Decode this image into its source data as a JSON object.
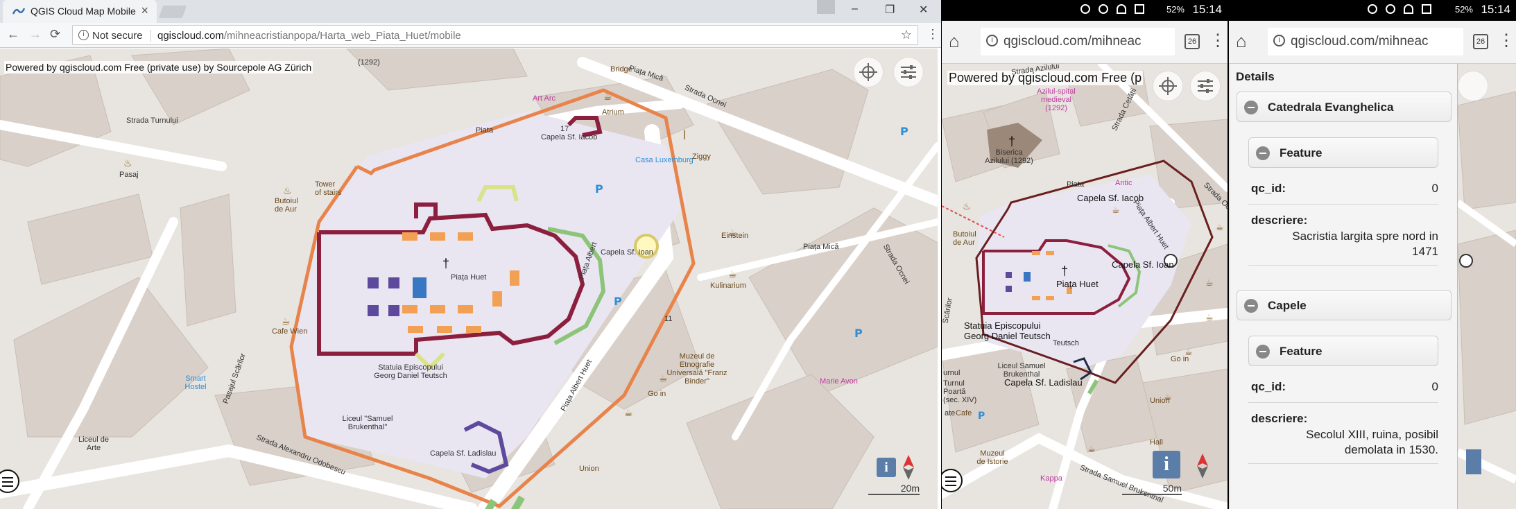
{
  "desktop": {
    "tab_title": "QGIS Cloud Map Mobile",
    "tab_close": "×",
    "window_controls": [
      "–",
      "❐",
      "✕"
    ],
    "nav": {
      "back": "←",
      "forward": "→",
      "reload": "⟳",
      "menu": "⋮"
    },
    "security_label": "Not secure",
    "url_host": "qgiscloud.com",
    "url_path": "/mihneacristianpopa/Harta_web_Piata_Huet/mobile",
    "bookmark_icon": "star-icon",
    "powered_by": "Powered by qgiscloud.com Free (private use) by Sourcepole AG Zürich",
    "info_button": "i",
    "scale": "20m",
    "labels": {
      "strada_turnului": "Strada Turnului",
      "piata_mica": "Piața Mică",
      "strada_ocnei": "Strada Ocnei",
      "piata_mica2": "Piața Mică",
      "strada_ocnei2": "Strada Ocnei",
      "capela_iacob": "Capela Sf. Iacob",
      "capela_ioan": "Capela Sf. Ioan",
      "capela_ladislau": "Capela Sf. Ladislau",
      "piata_huet": "Piața Huet",
      "piata_albert_huet": "Piața Albert Huet",
      "piata_albert": "Piața Albert",
      "statuia": "Statuia Episcopului Georg Daniel Teutsch",
      "pasajul": "Pasajul Scărilor",
      "strada_odobescu": "Strada Alexandru Odobescu",
      "liceul_samuel": "Liceul \"Samuel Brukenthal\"",
      "liceul_arte": "Liceul de Arte",
      "muzeul": "Muzeul de Etnografie Universală \"Franz Binder\"",
      "pasaj": "Pasaj",
      "tower": "Tower of stairs",
      "butoiul": "Butoiul de Aur",
      "cafe_wien": "Cafe Wien",
      "smart_hostel": "Smart Hostel",
      "atrium": "Atrium",
      "art_arc": "Art Arc",
      "casa_lux": "Casa Luxemburg",
      "ziggy": "Ziggy",
      "einstein": "Einstein",
      "kulinarium": "Kulinarium",
      "go_in": "Go in",
      "union": "Union",
      "marie_avon": "Marie Avon",
      "piata": "Piata",
      "bridge": "Bridge",
      "year": "(1292)",
      "num11": "11",
      "num17": "17"
    }
  },
  "phone1": {
    "status": {
      "battery": "52%",
      "time": "15:14"
    },
    "url": "qgiscloud.com/mihneac",
    "tabs_count": "26",
    "powered_by": "Powered by qgiscloud.com Free (p",
    "info_button": "i",
    "scale": "50m",
    "labels": {
      "strada_azilului": "Strada Azilului",
      "azilul_medieval": "Azilul-spital medieval (1292)",
      "biserica": "Biserica Azilului (1292)",
      "piata": "Piata",
      "antic": "Antic",
      "capela_iacob": "Capela Sf. Iacob",
      "piata_albert_huet": "Piața Albert Huet",
      "capela_ioan": "Capela Sf. Ioan",
      "piata_huet": "Piața Huet",
      "statuia": "Statuia Episcopului Georg Daniel Teutsch",
      "capela_ladislau": "Capela Sf. Ladislau",
      "liceul": "Liceul Samuel Brukenthal",
      "turnul_poarta": "Turnul Poartă (sec. XIV)",
      "muzeul_istorie": "Muzeul de Istorie",
      "kappa": "Kappa",
      "strada_samuel": "Strada Samuel Brukenthal",
      "go_in": "Go in",
      "union": "Union",
      "butoiul": "Butoiul de Aur",
      "cafe": "Cafe",
      "strada_ocnei": "Strada Ocnei",
      "strada_cetatii": "Strada Cetății",
      "scarilor": "Scărilor",
      "urnul": "urnul",
      "ate": "ate",
      "hall": "Hall",
      "teutsch": "Teutsch"
    }
  },
  "phone2": {
    "status": {
      "battery": "52%",
      "time": "15:14"
    },
    "url": "qgiscloud.com/mihneac",
    "tabs_count": "26",
    "details": {
      "title": "Details",
      "groups": [
        {
          "name": "Catedrala Evanghelica",
          "feature_label": "Feature",
          "fields": [
            {
              "key": "qc_id:",
              "value": "0"
            },
            {
              "key": "descriere:",
              "value": "Sacristia largita spre nord in 1471"
            }
          ]
        },
        {
          "name": "Capele",
          "feature_label": "Feature",
          "fields": [
            {
              "key": "qc_id:",
              "value": "0"
            },
            {
              "key": "descriere:",
              "value": "Secolul XIII, ruina, posibil demolata in 1530."
            }
          ]
        }
      ]
    }
  },
  "colors": {
    "map_bg": "#e8e4df",
    "building": "#d9d0c9",
    "road": "#ffffff",
    "wall_orange": "#e8834a",
    "plaza": "#e9e6f2",
    "crimson": "#8c1f3e",
    "purple": "#5e4a9c",
    "orange_block": "#f2a054",
    "green": "#8cc47a",
    "blue": "#3a77c2",
    "detail_bg": "#f4f4f4"
  }
}
